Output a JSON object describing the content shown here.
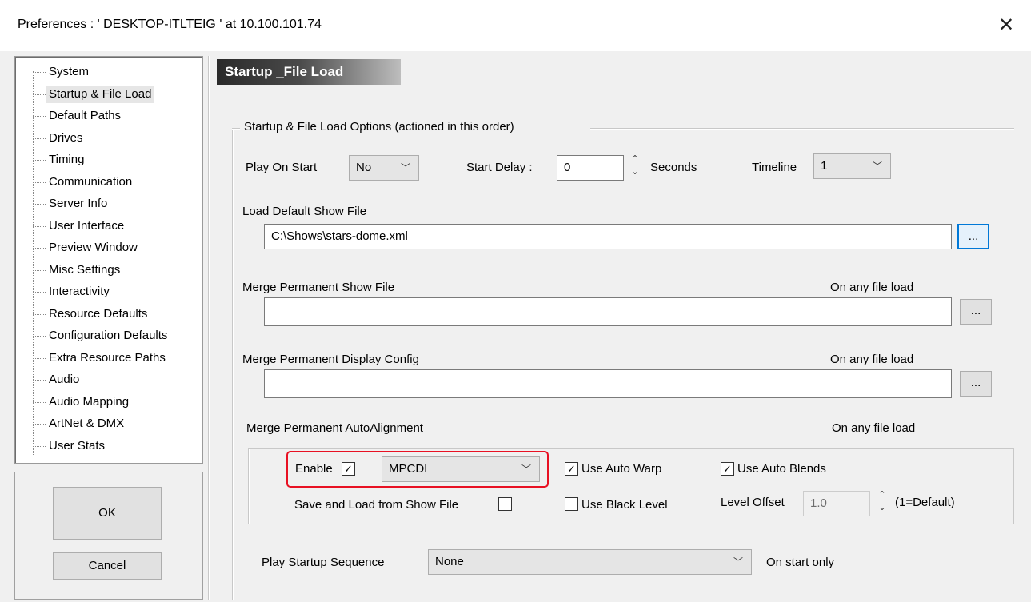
{
  "window": {
    "title": "Preferences :  ' DESKTOP-ITLTEIG ' at  10.100.101.74",
    "close_glyph": "✕"
  },
  "tree": {
    "items": [
      {
        "label": "System"
      },
      {
        "label": "Startup & File Load",
        "selected": true
      },
      {
        "label": "Default Paths"
      },
      {
        "label": "Drives"
      },
      {
        "label": "Timing"
      },
      {
        "label": "Communication"
      },
      {
        "label": "Server Info"
      },
      {
        "label": "User Interface"
      },
      {
        "label": "Preview Window"
      },
      {
        "label": "Misc Settings"
      },
      {
        "label": "Interactivity"
      },
      {
        "label": "Resource Defaults"
      },
      {
        "label": "Configuration Defaults"
      },
      {
        "label": "Extra Resource Paths"
      },
      {
        "label": "Audio"
      },
      {
        "label": "Audio Mapping"
      },
      {
        "label": "ArtNet & DMX"
      },
      {
        "label": "User Stats"
      }
    ]
  },
  "buttons": {
    "ok": "OK",
    "cancel": "Cancel"
  },
  "panel": {
    "header": "Startup _File Load",
    "group_title": "Startup & File Load Options (actioned in this order)",
    "play_on_start": {
      "label": "Play On Start",
      "value": "No"
    },
    "start_delay": {
      "label": "Start Delay :",
      "value": "0",
      "unit": "Seconds"
    },
    "timeline": {
      "label": "Timeline",
      "value": "1"
    },
    "load_default": {
      "label": "Load Default Show File",
      "value": "C:\\Shows\\stars-dome.xml",
      "browse": "..."
    },
    "merge_show": {
      "label": "Merge Permanent Show File",
      "note": "On any file load",
      "value": "",
      "browse": "..."
    },
    "merge_display": {
      "label": "Merge Permanent Display Config",
      "note": "On any file load",
      "value": "",
      "browse": "..."
    },
    "merge_auto": {
      "label": "Merge Permanent AutoAlignment",
      "note": "On any file load",
      "enable_label": "Enable",
      "enable_checked": true,
      "format_value": "MPCDI",
      "use_auto_warp": {
        "label": "Use Auto Warp",
        "checked": true
      },
      "use_auto_blends": {
        "label": "Use Auto Blends",
        "checked": true
      },
      "save_load_label": "Save and Load from Show File",
      "save_load_checked": false,
      "use_black_level": {
        "label": "Use Black Level",
        "checked": false
      },
      "level_offset": {
        "label": "Level Offset",
        "value": "1.0",
        "note": "(1=Default)"
      }
    },
    "startup_sequence": {
      "label": "Play Startup Sequence",
      "value": "None",
      "note": "On start only"
    }
  },
  "icons": {
    "combo_arrow": "﹀",
    "check": "✓",
    "spin_up": "⌃",
    "spin_down": "⌄"
  },
  "colors": {
    "highlight_red": "#e81123",
    "focus_blue": "#0078d7"
  }
}
